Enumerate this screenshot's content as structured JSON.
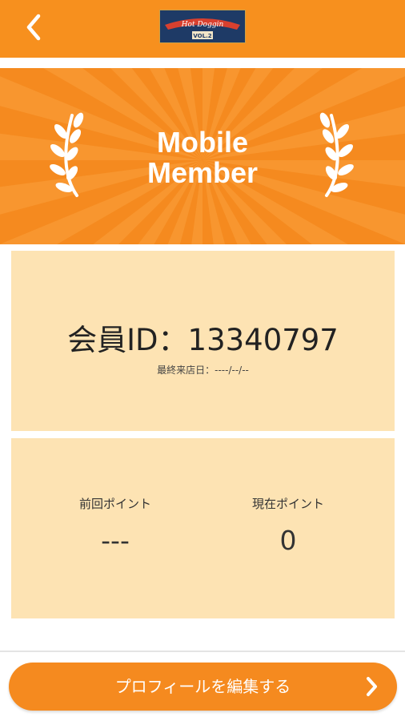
{
  "header": {
    "back_icon": "chevron-left-icon",
    "logo_line1": "Hot Doggin",
    "logo_line2": "VOL.2"
  },
  "banner": {
    "title_line1": "Mobile",
    "title_line2": "Member",
    "icon": "laurel-icon",
    "colors": {
      "base": "#f58a1f",
      "ray": "#f9a13c"
    }
  },
  "member": {
    "id_text": "会員ID：13340797",
    "last_visit": "最終来店日：----/--/--"
  },
  "points": {
    "previous_label": "前回ポイント",
    "previous_value": "---",
    "current_label": "現在ポイント",
    "current_value": "0"
  },
  "actions": {
    "edit_profile_label": "プロフィールを編集する",
    "edit_icon": "chevron-right-icon"
  },
  "colors": {
    "accent": "#f7901e",
    "card": "#fde3b3"
  }
}
